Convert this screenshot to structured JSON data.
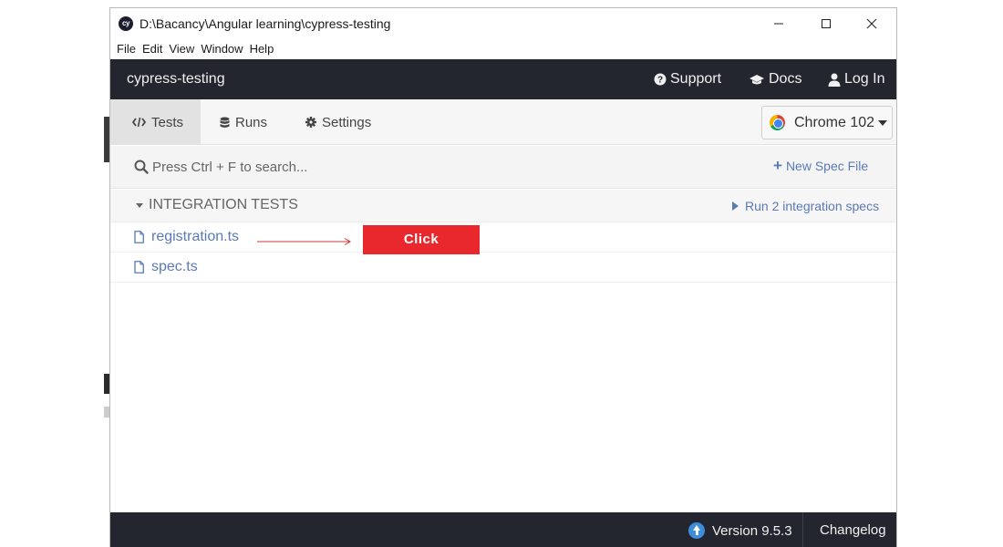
{
  "window": {
    "title": "D:\\Bacancy\\Angular learning\\cypress-testing",
    "app_icon_text": "cy"
  },
  "menu": [
    "File",
    "Edit",
    "View",
    "Window",
    "Help"
  ],
  "topnav": {
    "project": "cypress-testing",
    "support": "Support",
    "docs": "Docs",
    "login": "Log In"
  },
  "tabs": {
    "tests": "Tests",
    "runs": "Runs",
    "settings": "Settings",
    "active": "tests"
  },
  "browser": {
    "selected": "Chrome 102"
  },
  "search": {
    "placeholder": "Press Ctrl + F to search..."
  },
  "new_spec": "New Spec File",
  "integration": {
    "title": "INTEGRATION TESTS",
    "run_label": "Run 2 integration specs",
    "specs": [
      "registration.ts",
      "spec.ts"
    ]
  },
  "annotation": {
    "label": "Click",
    "color": "#e8282d"
  },
  "footer": {
    "version": "Version 9.5.3",
    "changelog": "Changelog"
  },
  "colors": {
    "nav_bg": "#23262f",
    "link": "#5a7ab5"
  }
}
